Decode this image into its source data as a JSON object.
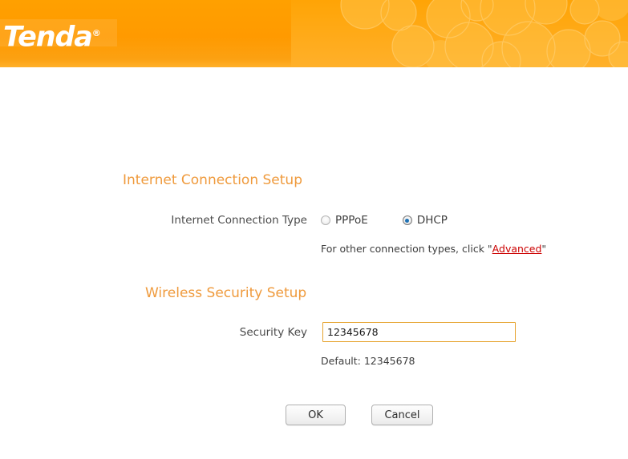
{
  "header": {
    "brand": "Tenda",
    "brand_registered": "®",
    "background_color": "#ff9a00",
    "decoration": "bubble-pattern"
  },
  "sections": {
    "internet": {
      "title": "Internet Connection Setup",
      "title_color": "#ef9a3c",
      "connection_type_label": "Internet Connection Type",
      "options": [
        {
          "label": "PPPoE",
          "selected": false
        },
        {
          "label": "DHCP",
          "selected": true
        }
      ],
      "hint_prefix": "For other connection types, click \"",
      "hint_link": "Advanced",
      "hint_suffix": "\"",
      "link_color": "#cc0000"
    },
    "wireless": {
      "title": "Wireless Security Setup",
      "title_color": "#ef9a3c",
      "security_key_label": "Security Key",
      "security_key_value": "12345678",
      "security_key_placeholder": "",
      "default_hint": "Default: 12345678",
      "input_focus_color": "#e6a32e"
    }
  },
  "buttons": {
    "ok": "OK",
    "cancel": "Cancel"
  }
}
